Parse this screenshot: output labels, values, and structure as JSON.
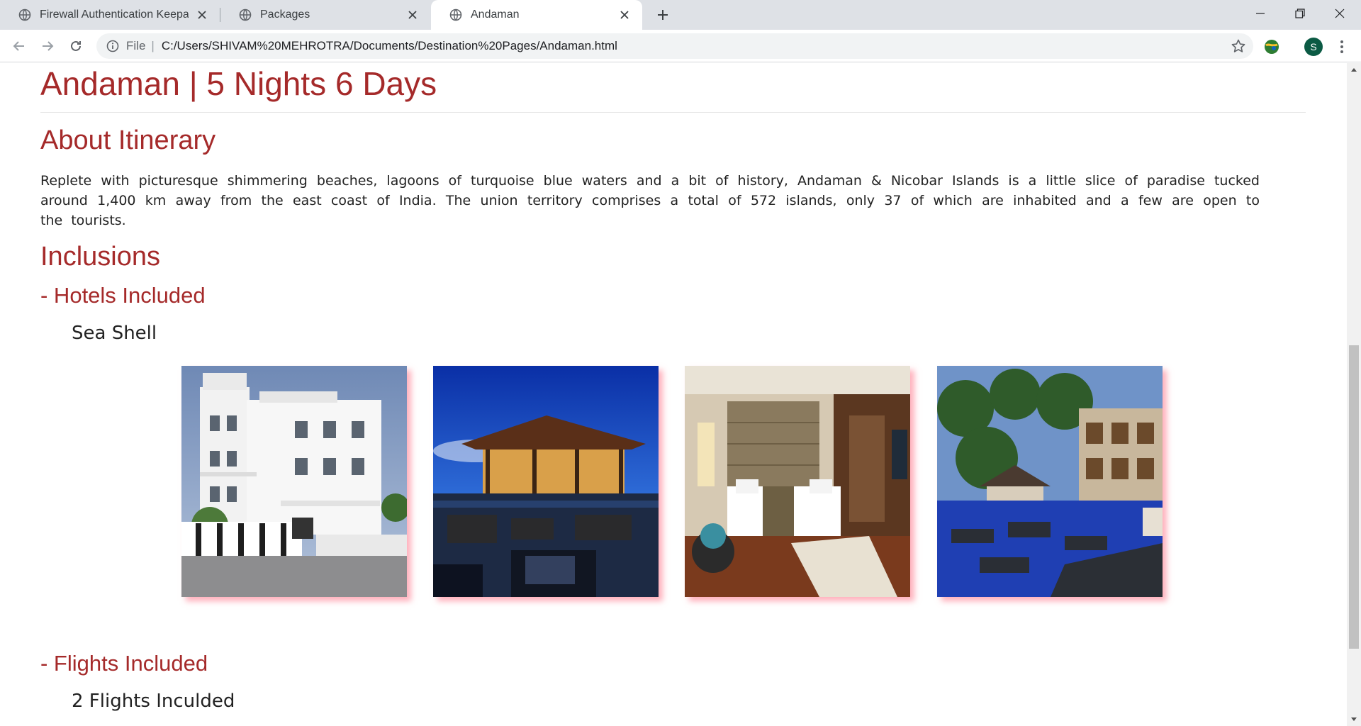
{
  "browser": {
    "tabs": [
      {
        "title": "Firewall Authentication Keepalive",
        "icon": "globe-icon"
      },
      {
        "title": "Packages",
        "icon": "globe-icon"
      },
      {
        "title": "Andaman",
        "icon": "globe-icon"
      }
    ],
    "address": {
      "scheme": "File",
      "url": "C:/Users/SHIVAM%20MEHROTRA/Documents/Destination%20Pages/Andaman.html"
    },
    "profile_initial": "S"
  },
  "page": {
    "title": "Andaman | 5 Nights 6 Days",
    "about_heading": "About Itinerary",
    "about_text": "Replete with picturesque shimmering beaches, lagoons of turquoise blue waters and a bit of history, Andaman & Nicobar Islands is a little slice of paradise tucked around 1,400 km away from the east coast of India. The union territory comprises a total of 572 islands, only 37 of which are inhabited and a few are open to the tourists.",
    "inclusions_heading": "Inclusions",
    "hotels_heading": "- Hotels Included",
    "hotel_name": "Sea Shell",
    "flights_heading": "- Flights Included",
    "flights_text": "2 Flights Inculded"
  },
  "colors": {
    "heading": "#a52a2a",
    "photo_shadow": "#ffb6c1"
  }
}
